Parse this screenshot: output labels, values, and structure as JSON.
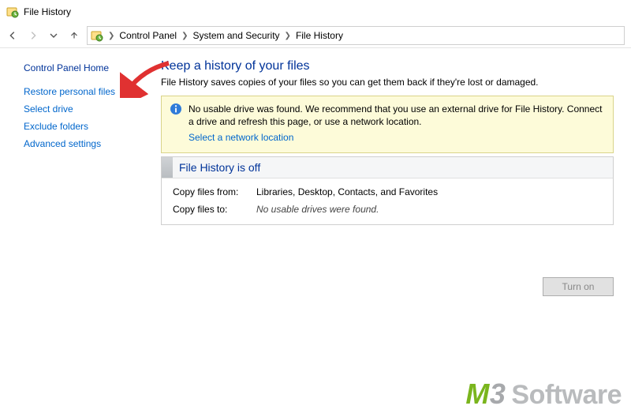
{
  "window": {
    "title": "File History"
  },
  "breadcrumb": {
    "items": [
      "Control Panel",
      "System and Security",
      "File History"
    ]
  },
  "sidebar": {
    "home": "Control Panel Home",
    "links": [
      "Restore personal files",
      "Select drive",
      "Exclude folders",
      "Advanced settings"
    ]
  },
  "main": {
    "heading": "Keep a history of your files",
    "description": "File History saves copies of your files so you can get them back if they're lost or damaged.",
    "warning": {
      "text": "No usable drive was found. We recommend that you use an external drive for File History. Connect a drive and refresh this page, or use a network location.",
      "link": "Select a network location"
    },
    "status": {
      "title": "File History is off",
      "copy_from_label": "Copy files from:",
      "copy_from_value": "Libraries, Desktop, Contacts, and Favorites",
      "copy_to_label": "Copy files to:",
      "copy_to_value": "No usable drives were found."
    },
    "action_button": "Turn on"
  },
  "watermark": {
    "brand_m": "M",
    "brand_3": "3",
    "brand_rest": "Software"
  }
}
